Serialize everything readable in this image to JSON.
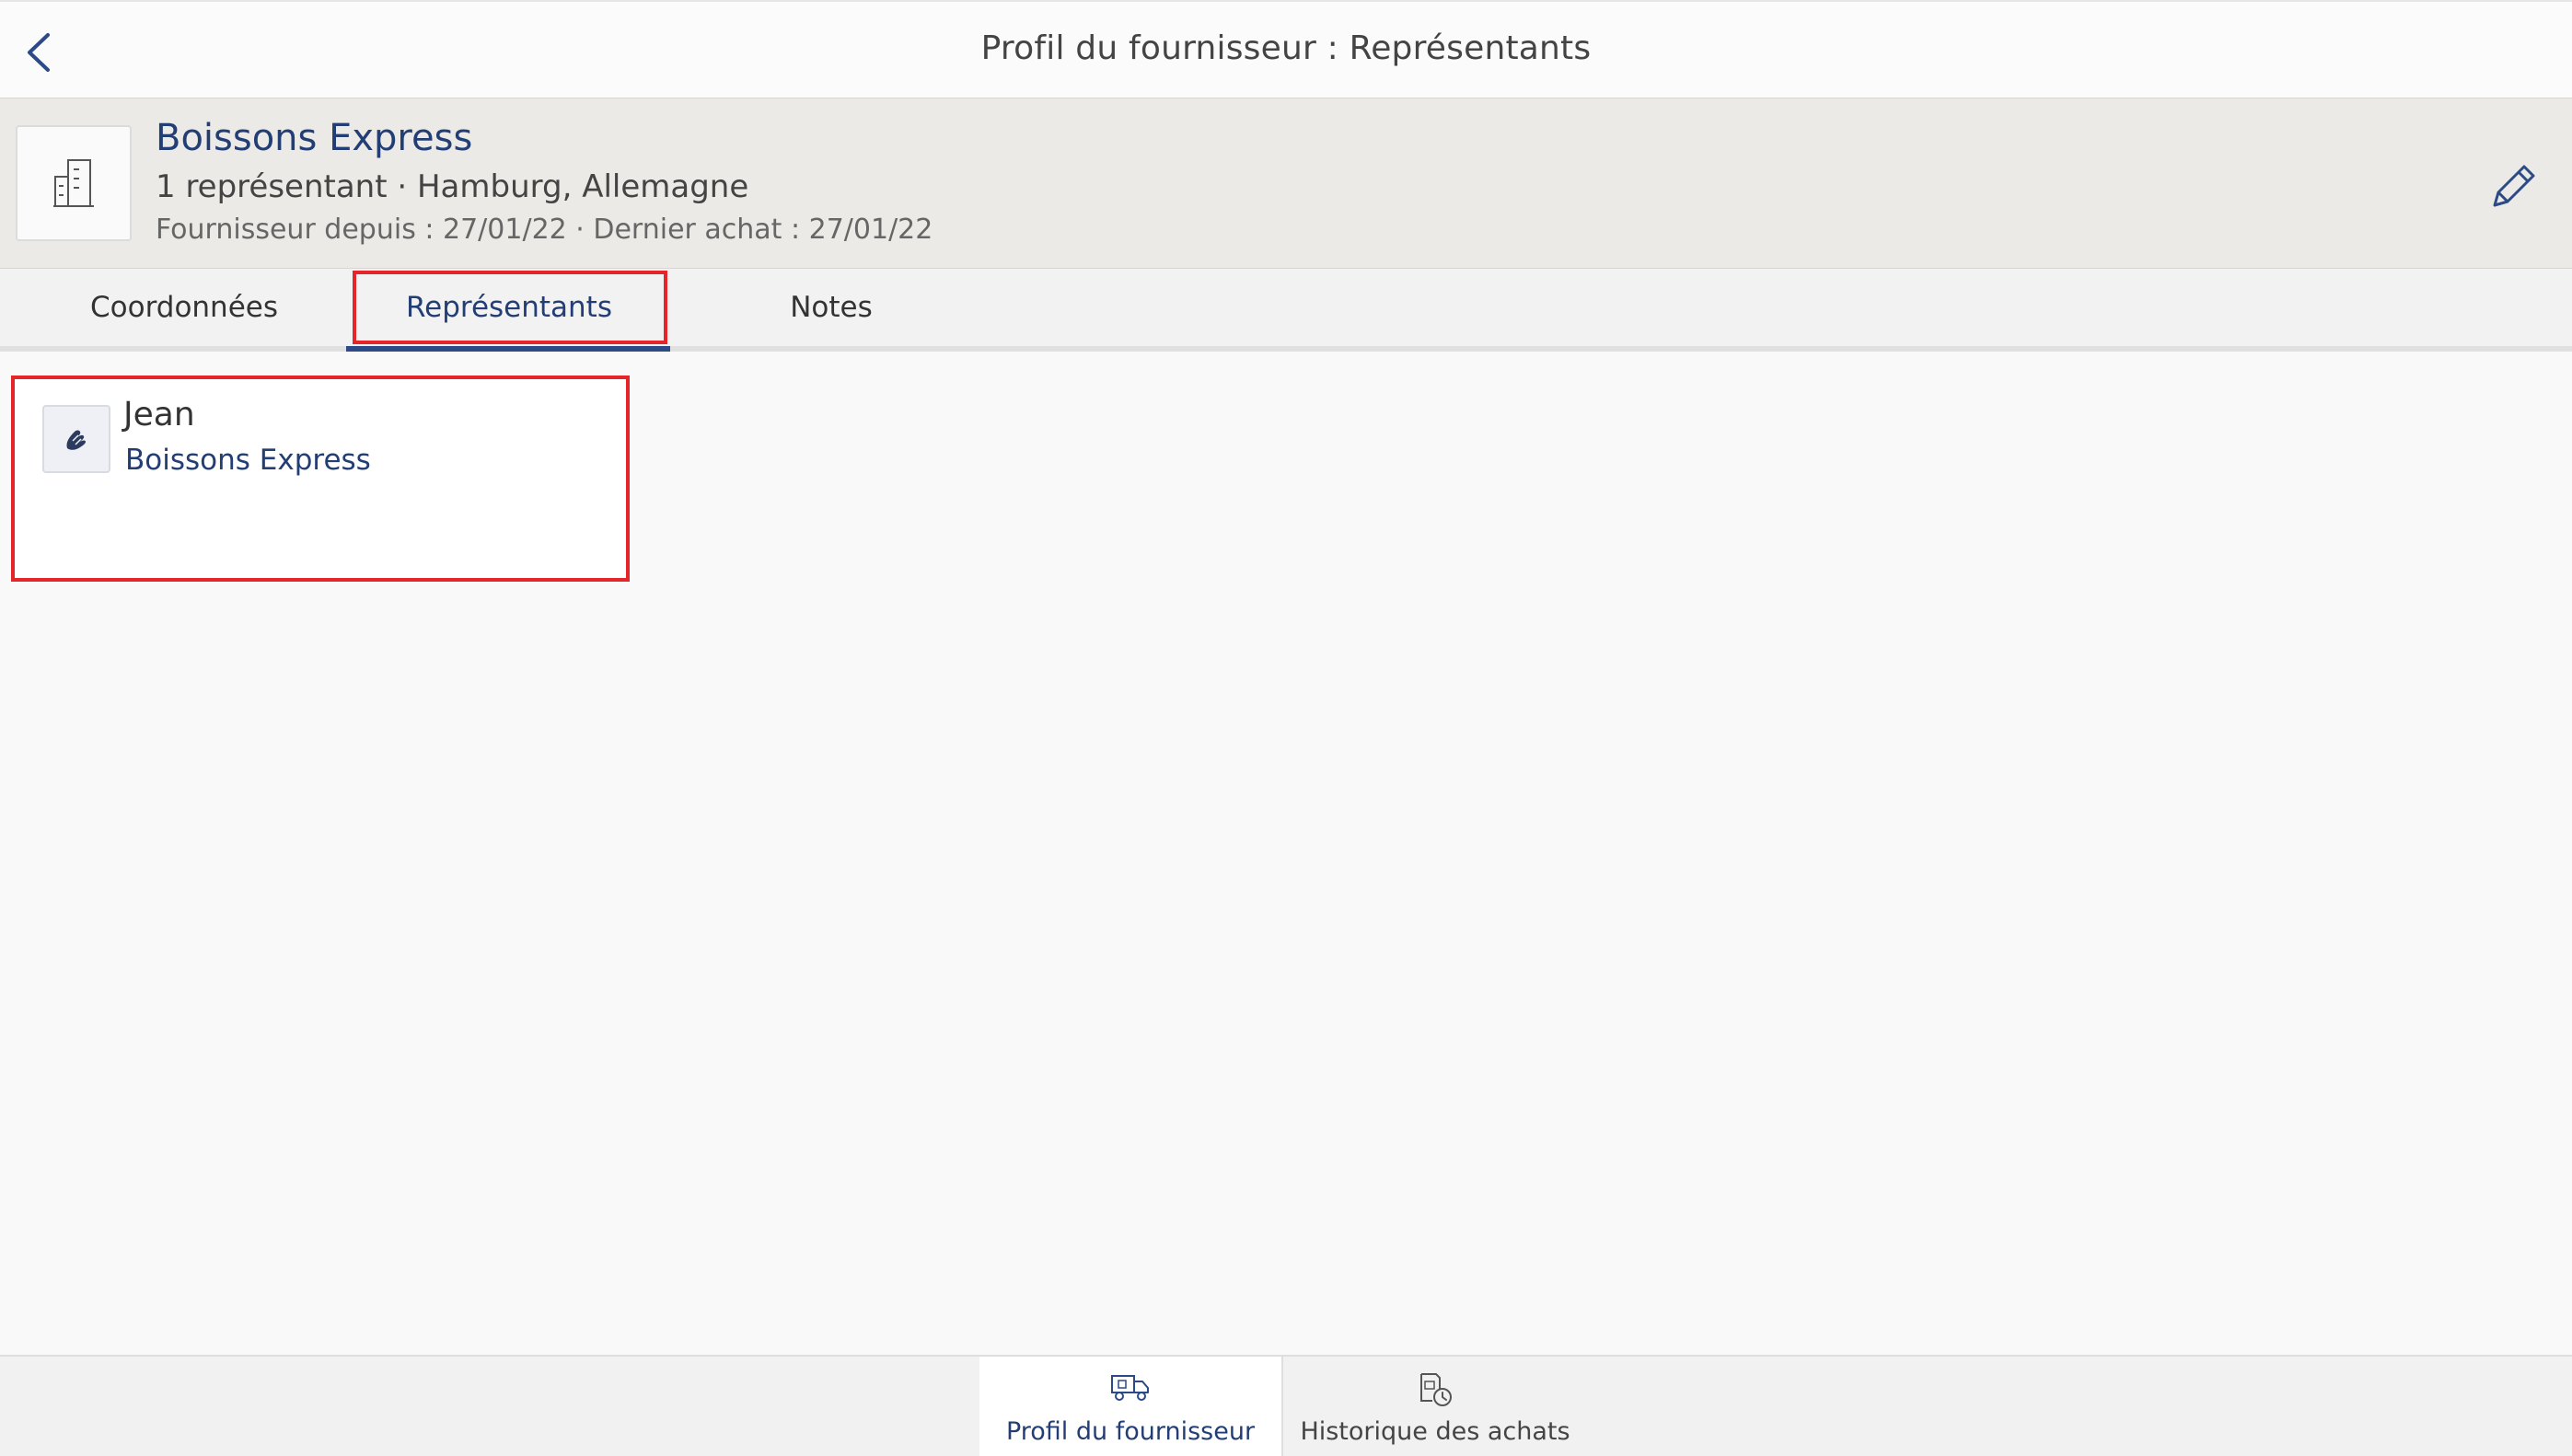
{
  "header": {
    "title": "Profil du fournisseur : Représentants"
  },
  "supplier": {
    "name": "Boissons Express",
    "summary": "1 représentant · Hamburg, Allemagne",
    "meta": "Fournisseur depuis : 27/01/22 · Dernier achat : 27/01/22"
  },
  "tabs": [
    {
      "label": "Coordonnées",
      "active": false
    },
    {
      "label": "Représentants",
      "active": true
    },
    {
      "label": "Notes",
      "active": false
    }
  ],
  "representatives": [
    {
      "name": "Jean",
      "company": "Boissons Express"
    }
  ],
  "bottom_nav": [
    {
      "label": "Profil du fournisseur",
      "active": true,
      "icon": "truck-icon"
    },
    {
      "label": "Historique des achats",
      "active": false,
      "icon": "purchase-history-icon"
    }
  ],
  "colors": {
    "accent": "#233e74",
    "highlight": "#e4262b",
    "header_bg": "#ebeae6"
  }
}
